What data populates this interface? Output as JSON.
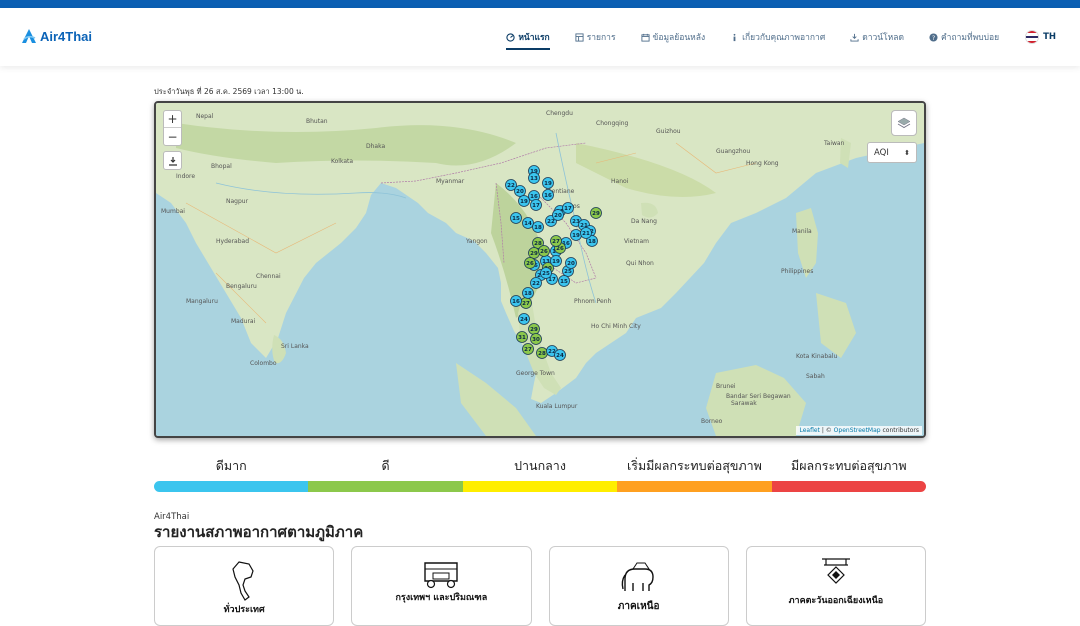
{
  "brand": {
    "name": "Air4Thai"
  },
  "nav": {
    "items": [
      {
        "label": "หน้าแรก",
        "icon": "gauge-icon",
        "active": true
      },
      {
        "label": "รายการ",
        "icon": "list-icon",
        "active": false
      },
      {
        "label": "ข้อมูลย้อนหลัง",
        "icon": "calendar-icon",
        "active": false
      },
      {
        "label": "เกี่ยวกับคุณภาพอากาศ",
        "icon": "info-icon",
        "active": false
      },
      {
        "label": "ดาวน์โหลด",
        "icon": "download-icon",
        "active": false
      },
      {
        "label": "คำถามที่พบบ่อย",
        "icon": "question-icon",
        "active": false
      }
    ],
    "lang": "TH"
  },
  "report_time": "ประจำวันพุธ ที่ 26 ส.ค. 2569 เวลา 13:00 น.",
  "map": {
    "zoom_in": "+",
    "zoom_out": "−",
    "index_select": "AQI",
    "attribution_leaflet": "Leaflet",
    "attribution_sep": " | © ",
    "attribution_osm": "OpenStreetMap",
    "attribution_tail": " contributors",
    "places": [
      "Nepal",
      "Bhutan",
      "Chengdu",
      "Chongqing",
      "Guizhou",
      "Guangzhou",
      "Hong Kong",
      "Taiwan",
      "Kolkata",
      "Dhaka",
      "Myanmar",
      "Laos",
      "Vietnam",
      "Hanoi",
      "Philippines",
      "Manila",
      "Chennai",
      "Bengaluru",
      "Sri Lanka",
      "Colombo",
      "Kuala Lumpur",
      "Phnom Penh",
      "Ho Chi Minh City",
      "Borneo",
      "Mumbai",
      "Hyderabad",
      "Nagpur",
      "Indore",
      "Bhopal",
      "Madurai",
      "Mangaluru",
      "Vientiane",
      "Yangon",
      "Da Nang",
      "Qui Nhon",
      "George Town",
      "Kota Kinabalu",
      "Brunei",
      "Sabah",
      "Sarawak",
      "Bandar Seri Begawan"
    ],
    "station_values": [
      19,
      13,
      22,
      20,
      16,
      19,
      17,
      19,
      16,
      21,
      15,
      14,
      18,
      22,
      20,
      17,
      23,
      21,
      12,
      19,
      18,
      16,
      17,
      13,
      16,
      21,
      17,
      29,
      21,
      26,
      28,
      29,
      26,
      26,
      30,
      25,
      27,
      24,
      29,
      31,
      30,
      27,
      28,
      22,
      24,
      19,
      20,
      15,
      16,
      18,
      22,
      25,
      27
    ]
  },
  "legend": {
    "labels": [
      "ดีมาก",
      "ดี",
      "ปานกลาง",
      "เริ่มมีผลกระทบต่อสุขภาพ",
      "มีผลกระทบต่อสุขภาพ"
    ],
    "colors": [
      "#3bc5ee",
      "#8cc84b",
      "#ffee00",
      "#ffa020",
      "#ec4444"
    ]
  },
  "regional": {
    "subtitle": "Air4Thai",
    "title": "รายงานสภาพอากาศตามภูมิภาค",
    "cards": [
      {
        "label": "ทั่วประเทศ",
        "icon": "thailand-map-icon"
      },
      {
        "label": "กรุงเทพฯ และปริมณฑล",
        "icon": "tuk-tuk-icon"
      },
      {
        "label": "ภาคเหนือ",
        "icon": "elephant-icon"
      },
      {
        "label": "ภาคตะวันออกเฉียงเหนือ",
        "icon": "pavilion-icon"
      }
    ]
  }
}
